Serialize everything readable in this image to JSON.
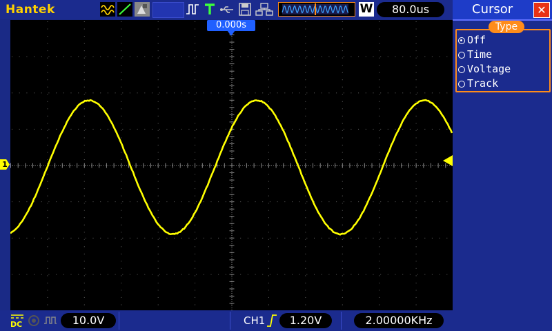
{
  "header": {
    "brand": "Hantek",
    "memory_icon": "W",
    "timebase": "80.0us",
    "trigger_position": "0.000s"
  },
  "panel": {
    "title": "Cursor",
    "close_icon": "close-icon",
    "type_label": "Type",
    "options": [
      {
        "label": "Off",
        "selected": true
      },
      {
        "label": "Time",
        "selected": false
      },
      {
        "label": "Voltage",
        "selected": false
      },
      {
        "label": "Track",
        "selected": false
      }
    ]
  },
  "bottom": {
    "coupling": "DC",
    "ch_scale": "10.0V",
    "trigger_source": "CH1",
    "trigger_level": "1.20V",
    "frequency": "2.00000KHz"
  },
  "channel_marker": "1",
  "colors": {
    "trace": "#ffff00",
    "accent": "#ff8c1a",
    "grid": "#5a5a5a"
  }
}
